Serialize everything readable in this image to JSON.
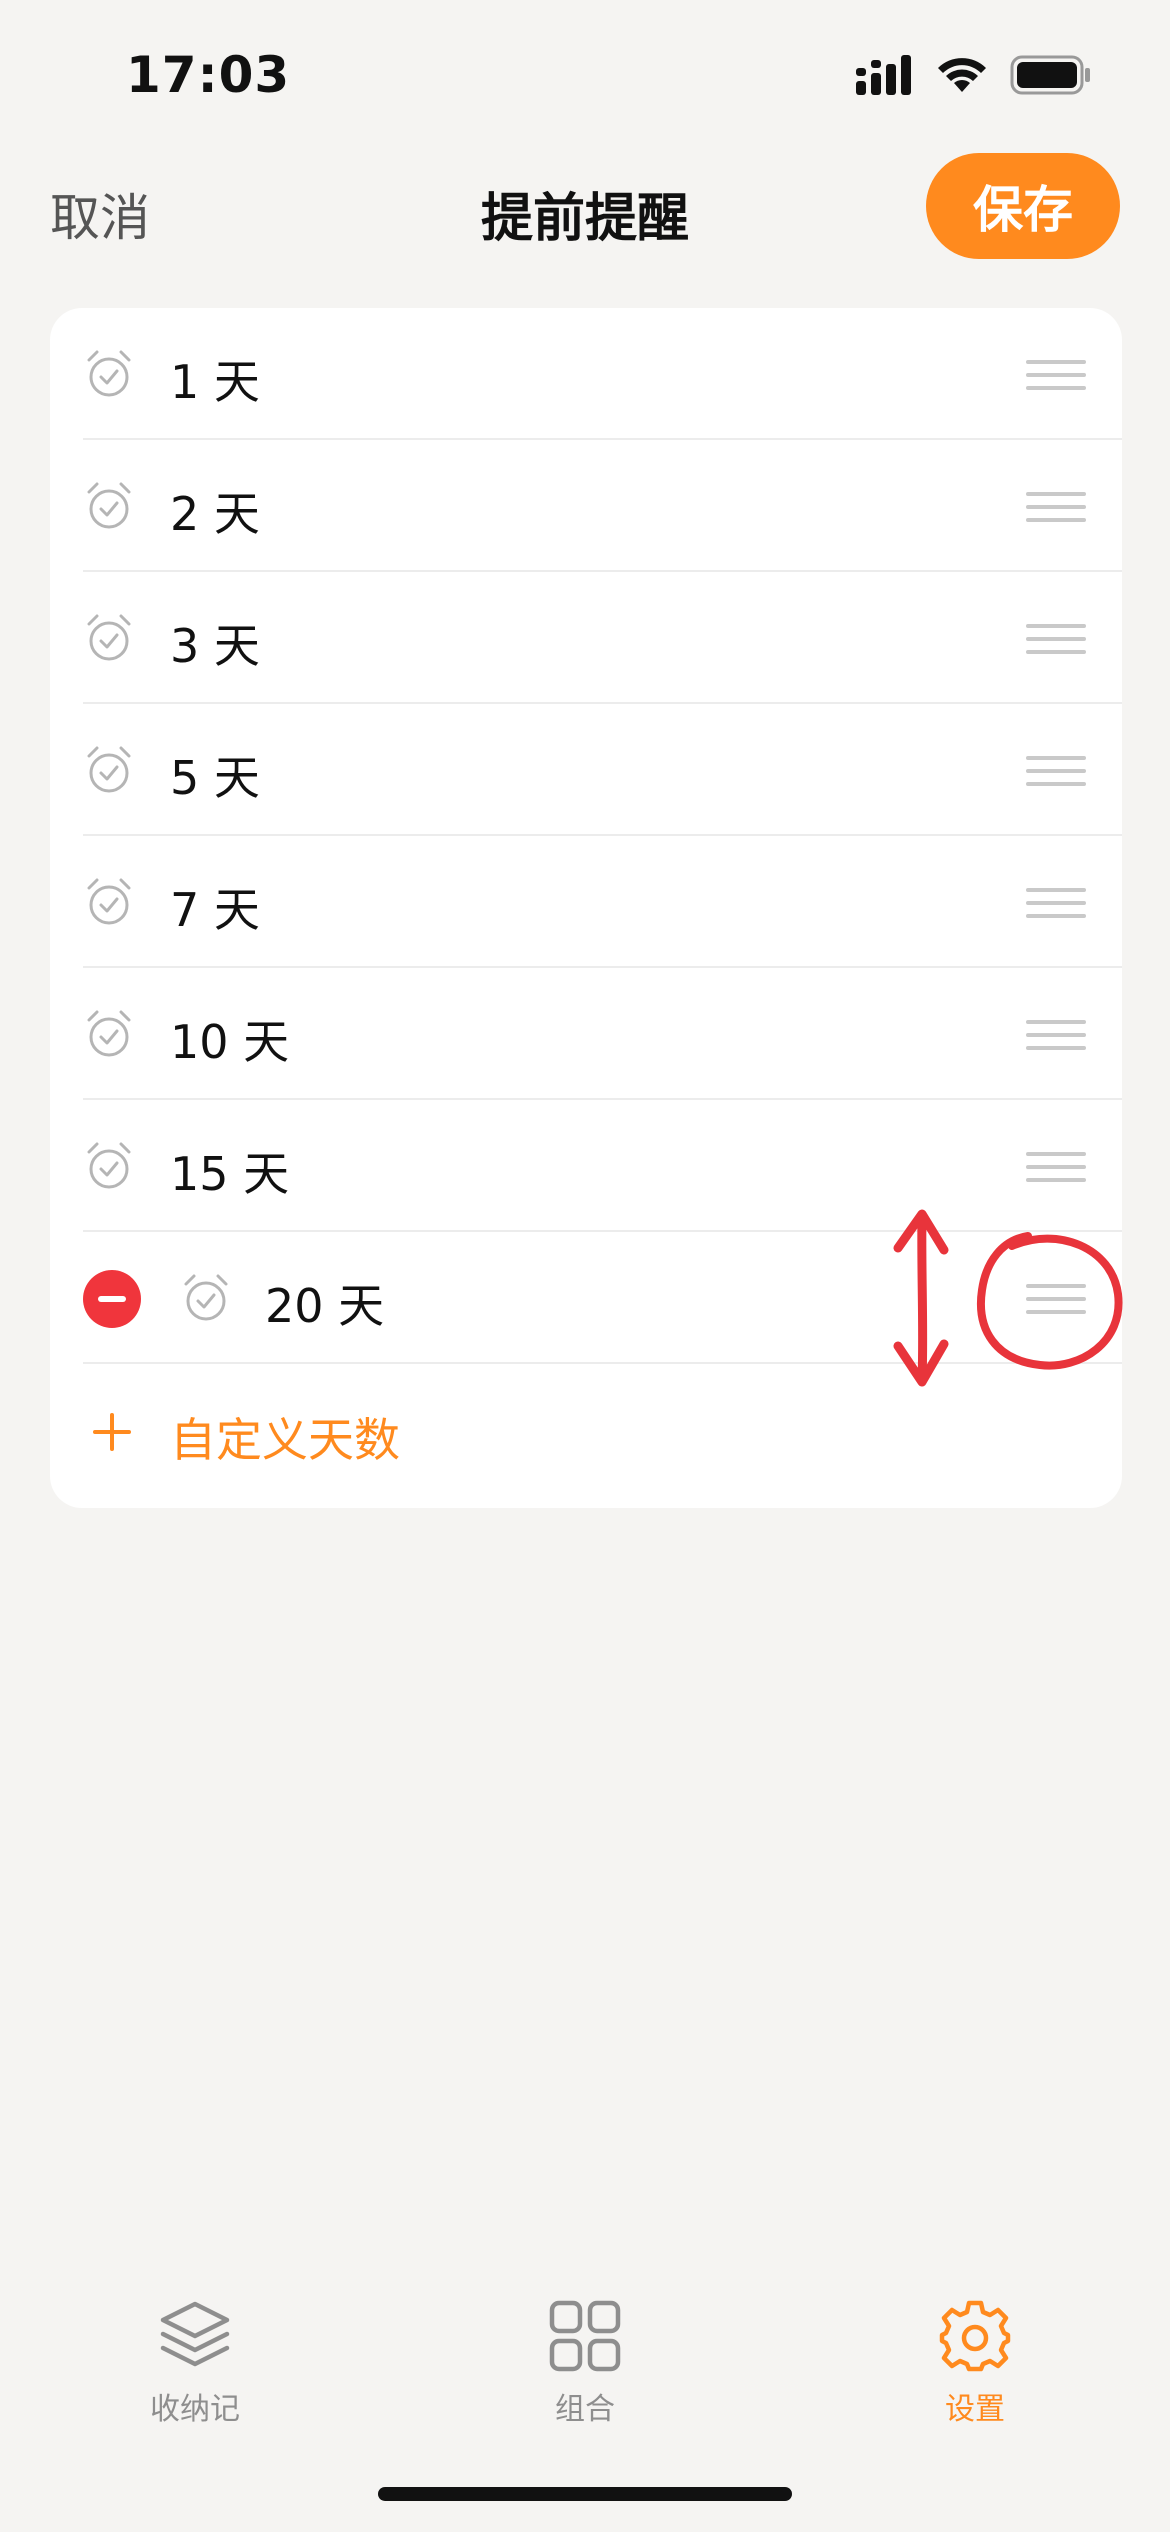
{
  "status_bar": {
    "time": "17:03"
  },
  "nav": {
    "cancel": "取消",
    "title": "提前提醒",
    "save": "保存"
  },
  "reminders": [
    {
      "label": "1 天"
    },
    {
      "label": "2 天"
    },
    {
      "label": "3 天"
    },
    {
      "label": "5 天"
    },
    {
      "label": "7 天"
    },
    {
      "label": "10 天"
    },
    {
      "label": "15 天"
    },
    {
      "label": "20 天",
      "deletable": true
    }
  ],
  "add_custom": "自定义天数",
  "tabs": [
    {
      "label": "收纳记",
      "icon": "stack-icon",
      "active": false
    },
    {
      "label": "组合",
      "icon": "grid-icon",
      "active": false
    },
    {
      "label": "设置",
      "icon": "gear-icon",
      "active": true
    }
  ],
  "colors": {
    "accent": "#FF8A1E",
    "delete": "#F0353C",
    "annotation": "#E8343B",
    "background": "#F5F4F2"
  }
}
